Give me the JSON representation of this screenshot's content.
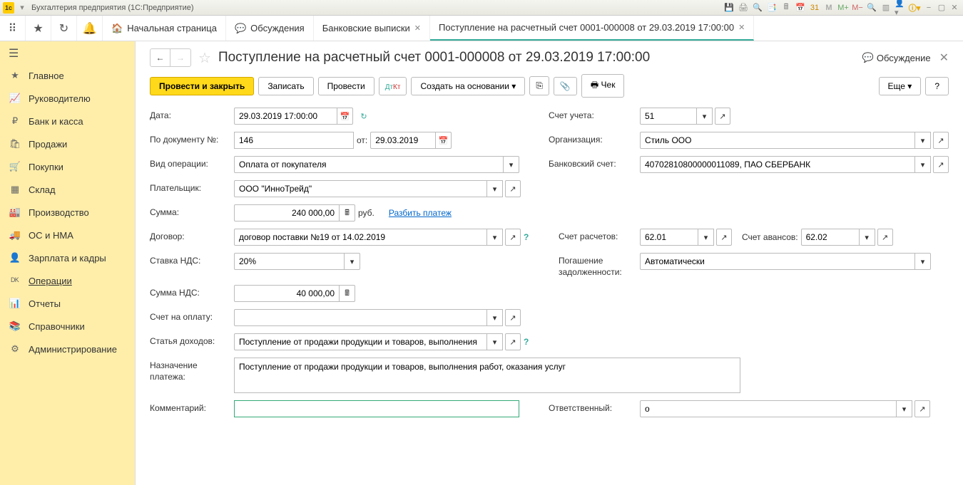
{
  "titlebar": {
    "app_name": "Бухгалтерия предприятия  (1С:Предприятие)"
  },
  "tabs": [
    {
      "label": "Начальная страница"
    },
    {
      "label": "Обсуждения"
    },
    {
      "label": "Банковские выписки"
    },
    {
      "label": "Поступление на расчетный счет 0001-000008 от 29.03.2019 17:00:00"
    }
  ],
  "sidebar": [
    {
      "label": "Главное",
      "icon": "★"
    },
    {
      "label": "Руководителю",
      "icon": "📈"
    },
    {
      "label": "Банк и касса",
      "icon": "₽"
    },
    {
      "label": "Продажи",
      "icon": "🛍"
    },
    {
      "label": "Покупки",
      "icon": "🛒"
    },
    {
      "label": "Склад",
      "icon": "▦"
    },
    {
      "label": "Производство",
      "icon": "🏭"
    },
    {
      "label": "ОС и НМА",
      "icon": "🚚"
    },
    {
      "label": "Зарплата и кадры",
      "icon": "👤"
    },
    {
      "label": "Операции",
      "icon": "ᴰᴷ"
    },
    {
      "label": "Отчеты",
      "icon": "📊"
    },
    {
      "label": "Справочники",
      "icon": "📚"
    },
    {
      "label": "Администрирование",
      "icon": "⚙"
    }
  ],
  "doc": {
    "title": "Поступление на расчетный счет 0001-000008 от 29.03.2019 17:00:00",
    "discuss": "Обсуждение"
  },
  "toolbar": {
    "post_close": "Провести и закрыть",
    "save": "Записать",
    "post": "Провести",
    "create_based": "Создать на основании",
    "receipt": "Чек",
    "more": "Еще",
    "help": "?"
  },
  "form": {
    "date_lbl": "Дата:",
    "date_val": "29.03.2019 17:00:00",
    "acct_lbl": "Счет учета:",
    "acct_val": "51",
    "docnum_lbl": "По документу №:",
    "docnum_val": "146",
    "from_lbl": "от:",
    "docdate_val": "29.03.2019",
    "org_lbl": "Организация:",
    "org_val": "Стиль ООО",
    "optype_lbl": "Вид операции:",
    "optype_val": "Оплата от покупателя",
    "bank_lbl": "Банковский счет:",
    "bank_val": "40702810800000011089, ПАО СБЕРБАНК",
    "payer_lbl": "Плательщик:",
    "payer_val": "ООО \"ИнноТрейд\"",
    "sum_lbl": "Сумма:",
    "sum_val": "240 000,00",
    "rub": "руб.",
    "split": "Разбить платеж",
    "contract_lbl": "Договор:",
    "contract_val": "договор поставки №19 от 14.02.2019",
    "acct_settle_lbl": "Счет расчетов:",
    "acct_settle_val": "62.01",
    "acct_adv_lbl": "Счет авансов:",
    "acct_adv_val": "62.02",
    "vat_lbl": "Ставка НДС:",
    "vat_val": "20%",
    "debt_lbl": "Погашение задолженности:",
    "debt_val": "Автоматически",
    "vatsum_lbl": "Сумма НДС:",
    "vatsum_val": "40 000,00",
    "invoice_lbl": "Счет на оплату:",
    "invoice_val": "",
    "income_lbl": "Статья доходов:",
    "income_val": "Поступление от продажи продукции и товаров, выполнения",
    "purpose_lbl": "Назначение платежа:",
    "purpose_val": "Поступление от продажи продукции и товаров, выполнения работ, оказания услуг",
    "comment_lbl": "Комментарий:",
    "comment_val": "",
    "resp_lbl": "Ответственный:",
    "resp_val": "о"
  }
}
